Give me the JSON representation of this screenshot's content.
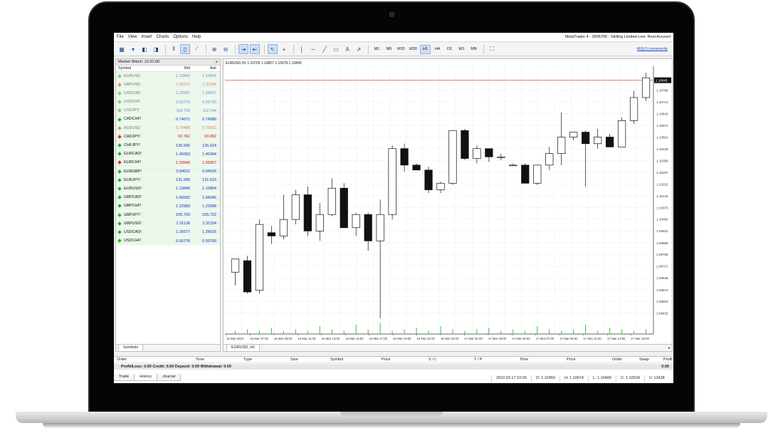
{
  "app": {
    "window_title": "MetaTrader 4 - 3005790 - Skilling Limited-Live: Real Account",
    "menu": [
      "File",
      "View",
      "Insert",
      "Charts",
      "Options",
      "Help"
    ],
    "community_link": "MQL5.community"
  },
  "toolbar": {
    "timeframes": [
      "M1",
      "M5",
      "M15",
      "M30",
      "H1",
      "H4",
      "D1",
      "W1",
      "MN"
    ],
    "active_timeframe": "H1"
  },
  "market_watch": {
    "title": "Market Watch: 16:31:00",
    "close": "×",
    "columns": {
      "symbol": "Symbol",
      "bid": "Bid",
      "ask": "Ask"
    },
    "rows": [
      {
        "symbol": "EURUSD",
        "bid": "1.10840",
        "ask": "1.10854",
        "dir": "up",
        "dim": true
      },
      {
        "symbol": "GBPUSD",
        "bid": "1.31137",
        "ask": "1.31154",
        "dir": "down",
        "dim": true
      },
      {
        "symbol": "USDCAD",
        "bid": "1.26587",
        "ask": "1.26607",
        "dir": "up",
        "dim": true
      },
      {
        "symbol": "USDCHF",
        "bid": "0.93776",
        "ask": "0.93790",
        "dir": "up",
        "dim": true
      },
      {
        "symbol": "USDJPY",
        "bid": "118.728",
        "ask": "118.744",
        "dir": "up",
        "dim": true
      },
      {
        "symbol": "CADCHF!",
        "bid": "0.74071",
        "ask": "0.74089",
        "dir": "up",
        "dim": false
      },
      {
        "symbol": "AUDUSD",
        "bid": "0.73486",
        "ask": "0.73502",
        "dir": "down",
        "dim": true
      },
      {
        "symbol": "CADJPY!",
        "bid": "93.762",
        "ask": "93.802",
        "dir": "down",
        "dim": false
      },
      {
        "symbol": "CHFJPY!",
        "bid": "126.606",
        "ask": "126.624",
        "dir": "up",
        "dim": false
      },
      {
        "symbol": "EURCAD!",
        "bid": "1.40303",
        "ask": "1.40344",
        "dir": "up",
        "dim": false
      },
      {
        "symbol": "EURCHF!",
        "bid": "1.03940",
        "ask": "1.03957",
        "dir": "down",
        "dim": false
      },
      {
        "symbol": "EURGBP!",
        "bid": "0.84511",
        "ask": "0.84526",
        "dir": "up",
        "dim": false
      },
      {
        "symbol": "EURJPY!",
        "bid": "131.606",
        "ask": "131.623",
        "dir": "up",
        "dim": false
      },
      {
        "symbol": "EURUSD!",
        "bid": "1.10840",
        "ask": "1.10854",
        "dir": "up",
        "dim": false
      },
      {
        "symbol": "GBPCAD!",
        "bid": "1.66002",
        "ask": "1.66046",
        "dir": "up",
        "dim": false
      },
      {
        "symbol": "GBPCHF!",
        "bid": "1.22983",
        "ask": "1.22998",
        "dir": "up",
        "dim": false
      },
      {
        "symbol": "GBPJPY!",
        "bid": "155.703",
        "ask": "155.722",
        "dir": "up",
        "dim": false
      },
      {
        "symbol": "GBPUSD!",
        "bid": "1.31136",
        "ask": "1.31154",
        "dir": "up",
        "dim": false
      },
      {
        "symbol": "USDCAD!",
        "bid": "1.26577",
        "ask": "1.26616",
        "dir": "up",
        "dim": false
      },
      {
        "symbol": "USDCHF!",
        "bid": "0.93776",
        "ask": "0.93790",
        "dir": "up",
        "dim": false
      }
    ],
    "tab": "Symbols"
  },
  "chart_window": {
    "info": "EURUSD,H1  1.10705 1.10857 1.10676 1.10845",
    "tab": "EURUSD, H1"
  },
  "chart_data": {
    "type": "candlestick",
    "symbol": "EURUSD",
    "timeframe": "H1",
    "current_price": 1.10845,
    "ylim": [
      1.09305,
      1.1093
    ],
    "y_ticks": [
      "1.10786",
      "1.10714",
      "1.10643",
      "1.10572",
      "1.10501",
      "1.10429",
      "1.10358",
      "1.10287",
      "1.10215",
      "1.10144",
      "1.10073",
      "1.10002",
      "1.09931",
      "1.09859",
      "1.09788",
      "1.09717",
      "1.09646",
      "1.09574",
      "1.09503",
      "1.09432"
    ],
    "x_labels": [
      "16 Mar 2022",
      "16 Mar 07:00",
      "16 Mar 09:00",
      "16 Mar 11:00",
      "16 Mar 13:00",
      "16 Mar 15:00",
      "16 Mar 17:00",
      "16 Mar 19:00",
      "16 Mar 21:00",
      "16 Mar 23:00",
      "17 Mar 01:00",
      "17 Mar 03:00",
      "17 Mar 05:00",
      "17 Mar 07:00",
      "17 Mar 09:00",
      "17 Mar 11:00",
      "17 Mar 13:00",
      "17 Mar 15:00"
    ],
    "candles": [
      {
        "o": 1.0968,
        "h": 1.0976,
        "l": 1.096,
        "c": 1.0976
      },
      {
        "o": 1.0975,
        "h": 1.0978,
        "l": 1.0955,
        "c": 1.0956
      },
      {
        "o": 1.0957,
        "h": 1.1,
        "l": 1.0955,
        "c": 1.0997
      },
      {
        "o": 1.0992,
        "h": 1.0996,
        "l": 1.0985,
        "c": 1.099
      },
      {
        "o": 1.099,
        "h": 1.1015,
        "l": 1.0988,
        "c": 1.1
      },
      {
        "o": 1.1,
        "h": 1.1018,
        "l": 1.0997,
        "c": 1.1015
      },
      {
        "o": 1.1015,
        "h": 1.102,
        "l": 1.099,
        "c": 1.0993
      },
      {
        "o": 1.0993,
        "h": 1.101,
        "l": 1.0987,
        "c": 1.1003
      },
      {
        "o": 1.1003,
        "h": 1.1025,
        "l": 1.1002,
        "c": 1.1019
      },
      {
        "o": 1.1019,
        "h": 1.1022,
        "l": 1.0995,
        "c": 1.0995
      },
      {
        "o": 1.0995,
        "h": 1.1004,
        "l": 1.099,
        "c": 1.1003
      },
      {
        "o": 1.1003,
        "h": 1.1004,
        "l": 1.0981,
        "c": 1.0987
      },
      {
        "o": 1.0987,
        "h": 1.1012,
        "l": 1.094,
        "c": 1.1003
      },
      {
        "o": 1.1003,
        "h": 1.1045,
        "l": 1.1,
        "c": 1.1043
      },
      {
        "o": 1.1043,
        "h": 1.1046,
        "l": 1.1029,
        "c": 1.1033
      },
      {
        "o": 1.1033,
        "h": 1.1034,
        "l": 1.103,
        "c": 1.103
      },
      {
        "o": 1.103,
        "h": 1.1032,
        "l": 1.1016,
        "c": 1.1018
      },
      {
        "o": 1.1018,
        "h": 1.1023,
        "l": 1.1016,
        "c": 1.1022
      },
      {
        "o": 1.1022,
        "h": 1.1054,
        "l": 1.1021,
        "c": 1.1054
      },
      {
        "o": 1.1054,
        "h": 1.1055,
        "l": 1.1036,
        "c": 1.1037
      },
      {
        "o": 1.1037,
        "h": 1.1045,
        "l": 1.1034,
        "c": 1.1043
      },
      {
        "o": 1.1043,
        "h": 1.1043,
        "l": 1.1035,
        "c": 1.1038
      },
      {
        "o": 1.1038,
        "h": 1.104,
        "l": 1.1036,
        "c": 1.1038
      },
      {
        "o": 1.1033,
        "h": 1.1034,
        "l": 1.1033,
        "c": 1.1033
      },
      {
        "o": 1.1033,
        "h": 1.1034,
        "l": 1.1022,
        "c": 1.1022
      },
      {
        "o": 1.1022,
        "h": 1.1033,
        "l": 1.1021,
        "c": 1.1033
      },
      {
        "o": 1.1033,
        "h": 1.1044,
        "l": 1.103,
        "c": 1.104
      },
      {
        "o": 1.104,
        "h": 1.1065,
        "l": 1.1033,
        "c": 1.105
      },
      {
        "o": 1.105,
        "h": 1.1053,
        "l": 1.1048,
        "c": 1.1053
      },
      {
        "o": 1.1053,
        "h": 1.1054,
        "l": 1.102,
        "c": 1.1046
      },
      {
        "o": 1.1046,
        "h": 1.1055,
        "l": 1.1043,
        "c": 1.105
      },
      {
        "o": 1.105,
        "h": 1.1052,
        "l": 1.1044,
        "c": 1.1044
      },
      {
        "o": 1.1044,
        "h": 1.1062,
        "l": 1.1044,
        "c": 1.106
      },
      {
        "o": 1.106,
        "h": 1.1078,
        "l": 1.1058,
        "c": 1.1074
      },
      {
        "o": 1.1074,
        "h": 1.1089,
        "l": 1.1072,
        "c": 1.1086
      }
    ],
    "volumes": [
      2,
      3,
      2,
      4,
      2,
      3,
      2,
      5,
      3,
      2,
      6,
      3,
      7,
      2,
      3,
      4,
      2,
      5,
      3,
      2,
      3,
      4,
      2,
      3,
      2,
      5,
      3,
      2,
      3,
      6,
      2,
      4,
      3,
      2,
      3
    ]
  },
  "terminal": {
    "columns": [
      "Order",
      "Time",
      "Type",
      "Size",
      "Symbol",
      "Price",
      "S / L",
      "T / P",
      "Time",
      "Price",
      "Order",
      "Swap",
      "Profit"
    ],
    "balance": "Profit/Loss: 0.00  Credit: 0.00  Deposit: 0.00  Withdrawal: 0.00",
    "balance_value": "0.00",
    "tabs": [
      "Trade",
      "History",
      "Journal"
    ],
    "active_tab": "History"
  },
  "statusbar": {
    "date": "2022.03.17 10:00",
    "open": "O: 1.10450",
    "high": "H: 1.10674",
    "low": "L: 1.10400",
    "close": "C: 1.10534",
    "volume": "V: 13428"
  },
  "colors": {
    "bid_blue": "#0a2cd6",
    "ask_red": "#d60a0a",
    "price_line": "#e2694a",
    "volume_green": "#2ec82e",
    "active_button": "#cfe0f3"
  }
}
